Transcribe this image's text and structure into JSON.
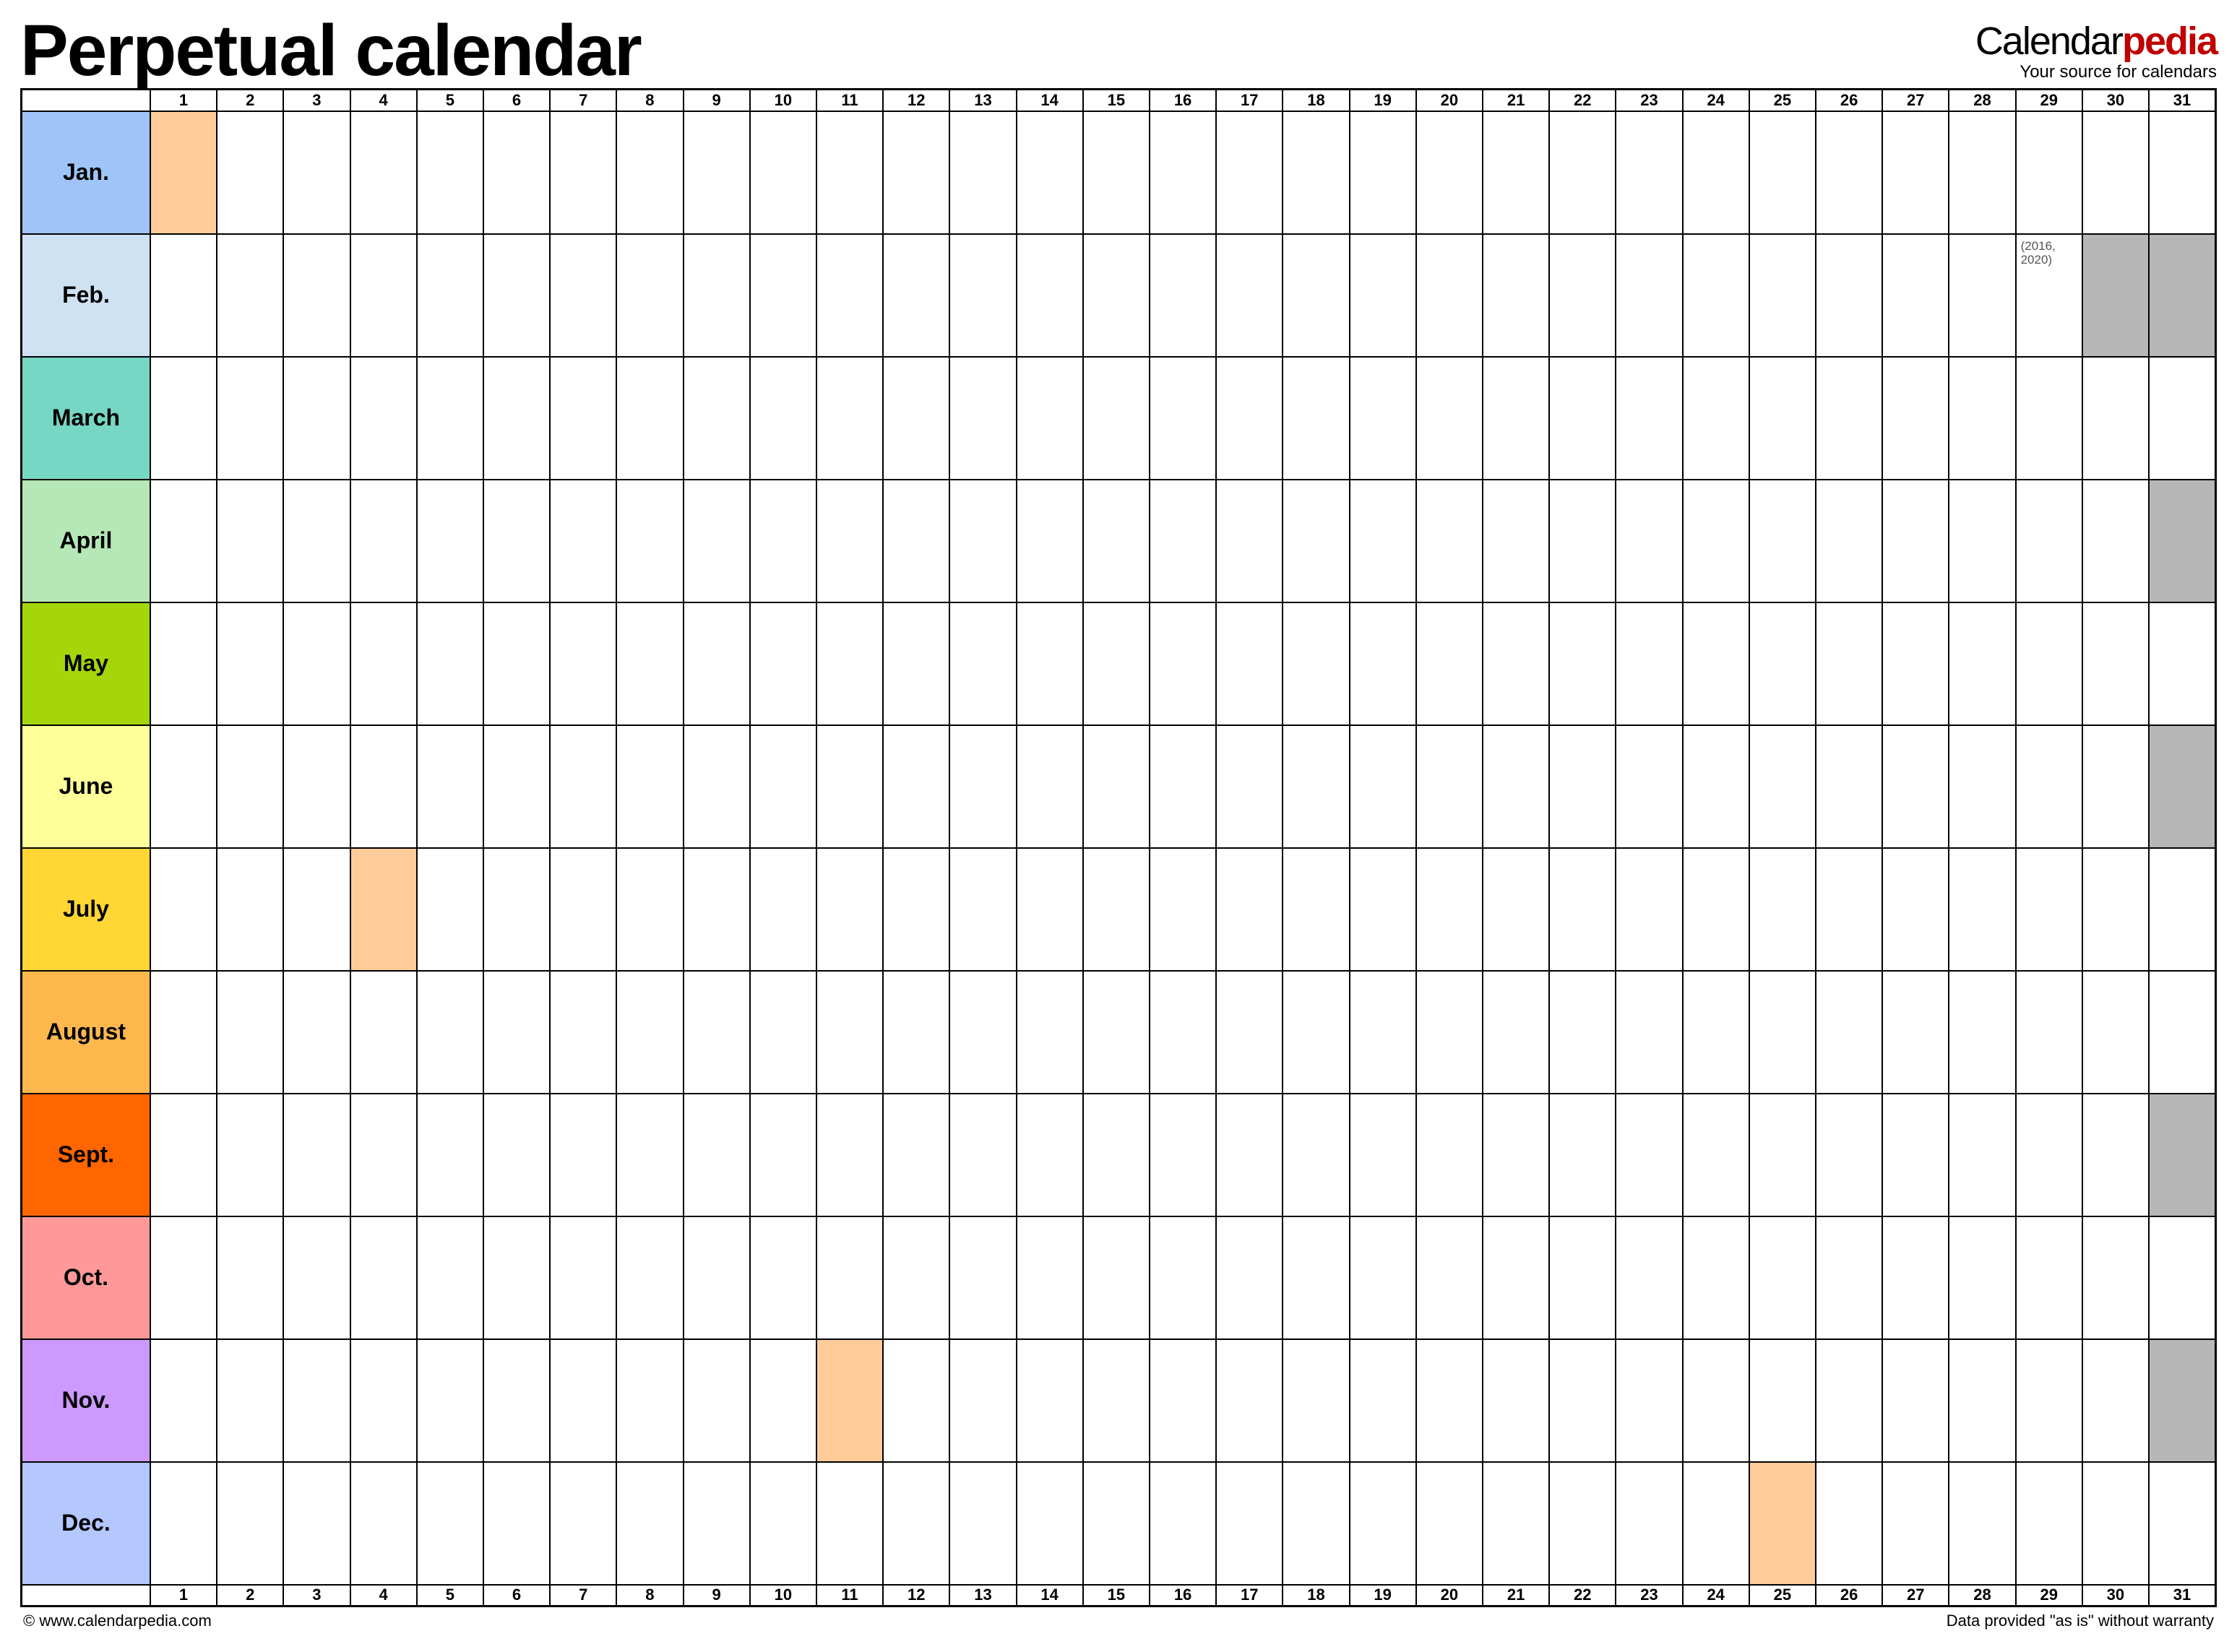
{
  "header": {
    "title": "Perpetual calendar",
    "brand_part1": "Calendar",
    "brand_part2": "pedia",
    "tagline": "Your source for calendars"
  },
  "day_numbers": [
    "1",
    "2",
    "3",
    "4",
    "5",
    "6",
    "7",
    "8",
    "9",
    "10",
    "11",
    "12",
    "13",
    "14",
    "15",
    "16",
    "17",
    "18",
    "19",
    "20",
    "21",
    "22",
    "23",
    "24",
    "25",
    "26",
    "27",
    "28",
    "29",
    "30",
    "31"
  ],
  "months": [
    {
      "label": "Jan.",
      "color": "#9fc5f8",
      "hl": [
        1
      ],
      "grey": [],
      "notes": {}
    },
    {
      "label": "Feb.",
      "color": "#cfe2f3",
      "hl": [],
      "grey": [
        30,
        31
      ],
      "notes": {
        "29": "(2016, 2020)"
      }
    },
    {
      "label": "March",
      "color": "#76d7c4",
      "hl": [],
      "grey": [],
      "notes": {}
    },
    {
      "label": "April",
      "color": "#b6e7b6",
      "hl": [],
      "grey": [
        31
      ],
      "notes": {}
    },
    {
      "label": "May",
      "color": "#a4d60b",
      "hl": [],
      "grey": [],
      "notes": {}
    },
    {
      "label": "June",
      "color": "#ffff99",
      "hl": [],
      "grey": [
        31
      ],
      "notes": {}
    },
    {
      "label": "July",
      "color": "#ffd633",
      "hl": [
        4
      ],
      "grey": [],
      "notes": {}
    },
    {
      "label": "August",
      "color": "#ffb84d",
      "hl": [],
      "grey": [],
      "notes": {}
    },
    {
      "label": "Sept.",
      "color": "#ff6600",
      "hl": [],
      "grey": [
        31
      ],
      "notes": {}
    },
    {
      "label": "Oct.",
      "color": "#ff9999",
      "hl": [],
      "grey": [],
      "notes": {}
    },
    {
      "label": "Nov.",
      "color": "#cc99ff",
      "hl": [
        11
      ],
      "grey": [
        31
      ],
      "notes": {}
    },
    {
      "label": "Dec.",
      "color": "#b4c7ff",
      "hl": [
        25
      ],
      "grey": [],
      "notes": {}
    }
  ],
  "footer": {
    "left": "© www.calendarpedia.com",
    "right": "Data provided \"as is\" without warranty"
  }
}
